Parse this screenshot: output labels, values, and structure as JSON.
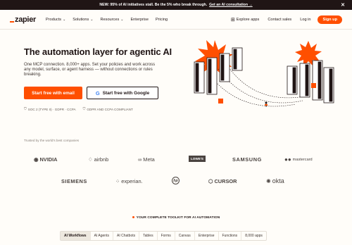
{
  "banner": {
    "text": "NEW: 95% of AI initiatives stall. Be the 5% who break through.",
    "link": "Get an AI consultation →",
    "close_icon": "close-icon"
  },
  "nav": {
    "logo": "zapier",
    "items": [
      "Products",
      "Solutions",
      "Resources",
      "Enterprise",
      "Pricing"
    ],
    "right": {
      "explore": "Explore apps",
      "contact": "Contact sales",
      "login": "Log in",
      "signup": "Sign up"
    }
  },
  "hero": {
    "title": "The automation layer for agentic AI",
    "subtitle": "One MCP connection. 8,000+ apps. Set your policies and work across any model, surface, or agent harness — without connections or rules breaking.",
    "cta_email": "Start free with email",
    "cta_google": "Start free with Google",
    "compliance": [
      "SOC 2 (TYPE II) · GDPR · CCPA",
      "GDPR AND CCPA COMPLIANT"
    ]
  },
  "trusted": {
    "label": "Trusted by the world's best companies",
    "logos": [
      "NVIDIA",
      "airbnb",
      "Meta",
      "LOWE'S",
      "SAMSUNG",
      "mastercard",
      "SIEMENS",
      "experian.",
      "hp",
      "CURSOR",
      "okta"
    ]
  },
  "toolkit": {
    "label": "YOUR COMPLETE TOOLKIT FOR AI AUTOMATION",
    "tabs": [
      "AI Workflows",
      "AI Agents",
      "AI Chatbots",
      "Tables",
      "Forms",
      "Canvas",
      "Enterprise",
      "Functions",
      "8,000 apps"
    ],
    "active": "AI Workflows"
  },
  "colors": {
    "accent": "#ff4f00",
    "dark": "#201515",
    "background": "#fffdf9"
  }
}
